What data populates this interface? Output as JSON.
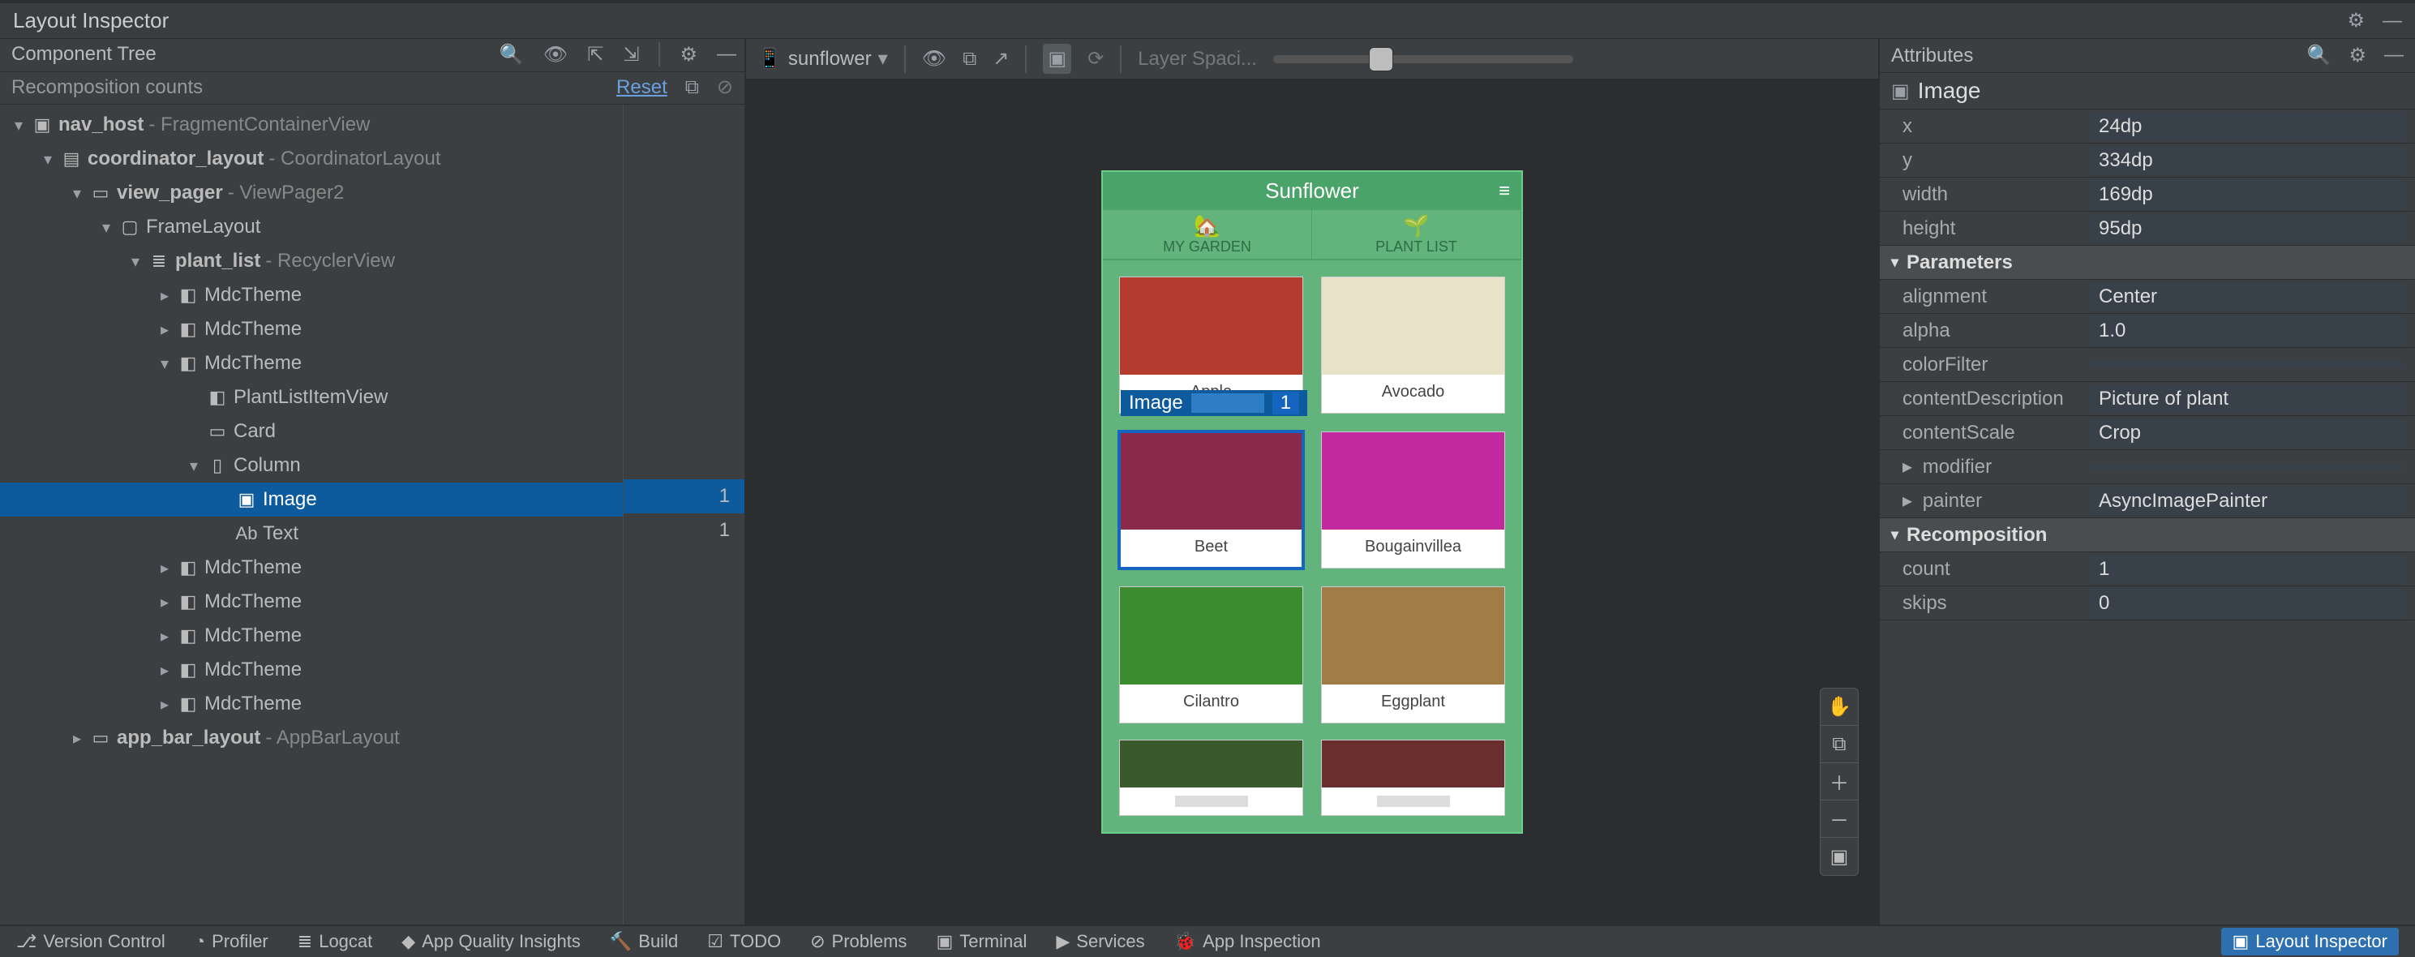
{
  "window": {
    "title": "Layout Inspector"
  },
  "leftPane": {
    "header": "Component Tree",
    "subHeader": {
      "left": "Recomposition counts",
      "reset": "Reset"
    },
    "tree": [
      {
        "depth": 0,
        "chev": "▾",
        "icon": "▣",
        "name": "nav_host",
        "desc": " - FragmentContainerView",
        "bold": true
      },
      {
        "depth": 1,
        "chev": "▾",
        "icon": "▤",
        "name": "coordinator_layout",
        "desc": " - CoordinatorLayout",
        "bold": true
      },
      {
        "depth": 2,
        "chev": "▾",
        "icon": "▭",
        "name": "view_pager",
        "desc": " - ViewPager2",
        "bold": true
      },
      {
        "depth": 3,
        "chev": "▾",
        "icon": "▢",
        "name": "FrameLayout",
        "desc": "",
        "bold": false
      },
      {
        "depth": 4,
        "chev": "▾",
        "icon": "≣",
        "name": "plant_list",
        "desc": " - RecyclerView",
        "bold": true
      },
      {
        "depth": 5,
        "chev": "▸",
        "icon": "◧",
        "name": "MdcTheme",
        "desc": "",
        "bold": false
      },
      {
        "depth": 5,
        "chev": "▸",
        "icon": "◧",
        "name": "MdcTheme",
        "desc": "",
        "bold": false
      },
      {
        "depth": 5,
        "chev": "▾",
        "icon": "◧",
        "name": "MdcTheme",
        "desc": "",
        "bold": false
      },
      {
        "depth": 6,
        "chev": "",
        "icon": "◧",
        "name": "PlantListItemView",
        "desc": "",
        "bold": false
      },
      {
        "depth": 6,
        "chev": "",
        "icon": "▭",
        "name": "Card",
        "desc": "",
        "bold": false
      },
      {
        "depth": 6,
        "chev": "▾",
        "icon": "▯",
        "name": "Column",
        "desc": "",
        "bold": false
      },
      {
        "depth": 7,
        "chev": "",
        "icon": "▣",
        "name": "Image",
        "desc": "",
        "bold": false,
        "selected": true,
        "count": "1"
      },
      {
        "depth": 7,
        "chev": "",
        "icon": "Ab",
        "name": "Text",
        "desc": "",
        "bold": false,
        "count": "1"
      },
      {
        "depth": 5,
        "chev": "▸",
        "icon": "◧",
        "name": "MdcTheme",
        "desc": "",
        "bold": false
      },
      {
        "depth": 5,
        "chev": "▸",
        "icon": "◧",
        "name": "MdcTheme",
        "desc": "",
        "bold": false
      },
      {
        "depth": 5,
        "chev": "▸",
        "icon": "◧",
        "name": "MdcTheme",
        "desc": "",
        "bold": false
      },
      {
        "depth": 5,
        "chev": "▸",
        "icon": "◧",
        "name": "MdcTheme",
        "desc": "",
        "bold": false
      },
      {
        "depth": 5,
        "chev": "▸",
        "icon": "◧",
        "name": "MdcTheme",
        "desc": "",
        "bold": false
      },
      {
        "depth": 2,
        "chev": "▸",
        "icon": "▭",
        "name": "app_bar_layout",
        "desc": " - AppBarLayout",
        "bold": true
      }
    ]
  },
  "center": {
    "device": "sunflower",
    "layerLabel": "Layer Spaci...",
    "overlay": {
      "label": "Image",
      "count": "1"
    },
    "app": {
      "title": "Sunflower",
      "tabs": [
        {
          "label": "MY GARDEN",
          "icon": "🏡"
        },
        {
          "label": "PLANT LIST",
          "icon": "🌱"
        }
      ],
      "cards": [
        {
          "label": "Apple",
          "bg": "#b33c2e",
          "sel": false
        },
        {
          "label": "Avocado",
          "bg": "#e8e3c8",
          "sel": false
        },
        {
          "label": "Beet",
          "bg": "#8a2a4a",
          "sel": true
        },
        {
          "label": "Bougainvillea",
          "bg": "#c42aa0",
          "sel": false
        },
        {
          "label": "Cilantro",
          "bg": "#3a8c2e",
          "sel": false
        },
        {
          "label": "Eggplant",
          "bg": "#a07c46",
          "sel": false
        }
      ]
    }
  },
  "rightPane": {
    "header": "Attributes",
    "selection": "Image",
    "groups": [
      {
        "rows": [
          {
            "key": "x",
            "val": "24dp"
          },
          {
            "key": "y",
            "val": "334dp"
          },
          {
            "key": "width",
            "val": "169dp"
          },
          {
            "key": "height",
            "val": "95dp"
          }
        ]
      },
      {
        "title": "Parameters",
        "rows": [
          {
            "key": "alignment",
            "val": "Center"
          },
          {
            "key": "alpha",
            "val": "1.0"
          },
          {
            "key": "colorFilter",
            "val": ""
          },
          {
            "key": "contentDescription",
            "val": "Picture of plant"
          },
          {
            "key": "contentScale",
            "val": "Crop"
          },
          {
            "key": "modifier",
            "val": "",
            "chev": "▸"
          },
          {
            "key": "painter",
            "val": "AsyncImagePainter",
            "chev": "▸"
          }
        ]
      },
      {
        "title": "Recomposition",
        "rows": [
          {
            "key": "count",
            "val": "1"
          },
          {
            "key": "skips",
            "val": "0"
          }
        ]
      }
    ]
  },
  "status": {
    "left": [
      {
        "icon": "⎇",
        "label": "Version Control"
      },
      {
        "icon": "◔",
        "label": "Profiler"
      },
      {
        "icon": "≣",
        "label": "Logcat"
      },
      {
        "icon": "◆",
        "label": "App Quality Insights"
      },
      {
        "icon": "🔨",
        "label": "Build"
      },
      {
        "icon": "☑",
        "label": "TODO"
      },
      {
        "icon": "⊘",
        "label": "Problems"
      },
      {
        "icon": "▣",
        "label": "Terminal"
      },
      {
        "icon": "▶",
        "label": "Services"
      },
      {
        "icon": "🐞",
        "label": "App Inspection"
      }
    ],
    "right": {
      "icon": "▣",
      "label": "Layout Inspector"
    }
  }
}
